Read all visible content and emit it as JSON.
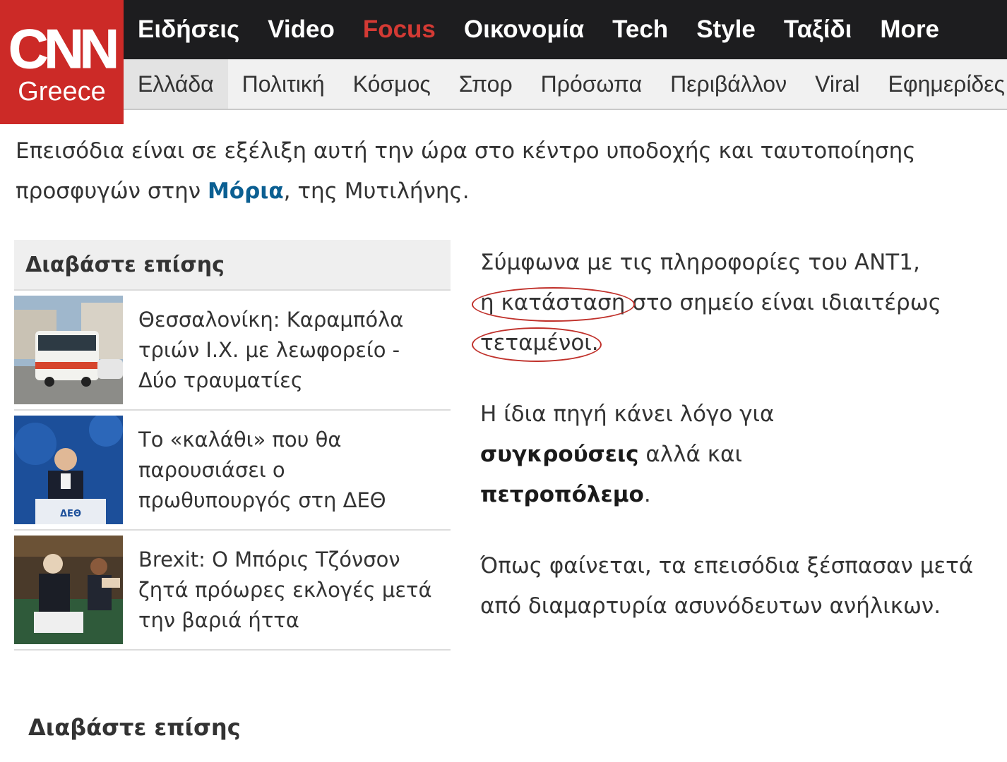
{
  "logo": {
    "mark": "CNN",
    "region": "Greece"
  },
  "topnav": [
    {
      "label": "Ειδήσεις"
    },
    {
      "label": "Video"
    },
    {
      "label": "Focus"
    },
    {
      "label": "Οικονομία"
    },
    {
      "label": "Tech"
    },
    {
      "label": "Style"
    },
    {
      "label": "Ταξίδι"
    },
    {
      "label": "More"
    }
  ],
  "subnav": [
    {
      "label": "Ελλάδα"
    },
    {
      "label": "Πολιτική"
    },
    {
      "label": "Κόσμος"
    },
    {
      "label": "Σπορ"
    },
    {
      "label": "Πρόσωπα"
    },
    {
      "label": "Περιβάλλον"
    },
    {
      "label": "Viral"
    },
    {
      "label": "Εφημερίδες"
    }
  ],
  "intro": {
    "before": "Επεισόδια είναι σε εξέλιξη αυτή την ώρα στο κέντρο υποδοχής και ταυτοποίησης προσφυγών στην ",
    "link": "Μόρια",
    "after": ", της Μυτιλήνης."
  },
  "sidebar": {
    "heading": "Διαβάστε επίσης",
    "items": [
      {
        "title": "Θεσσαλονίκη: Καραμπόλα τριών Ι.Χ. με λεωφορείο - Δύο τραυματίες"
      },
      {
        "title": "Το «καλάθι» που θα παρουσιάσει ο πρωθυπουργός στη ΔΕΘ",
        "thumb_sign": "ΔΕΘ"
      },
      {
        "title": "Brexit: Ο Μπόρις Τζόνσον ζητά πρόωρες εκλογές μετά την βαριά ήττα"
      }
    ]
  },
  "article": {
    "p1": {
      "a": "Σύμφωνα με τις πληροφορίες του ANT1,",
      "ring1": "η κατάσταση",
      "b": " στο σημείο είναι ιδιαιτέρως ",
      "ring2": "τεταμένοι",
      "c": "."
    },
    "p2": {
      "a": "Η ίδια πηγή κάνει λόγο για ",
      "bold1": "συγκρούσεις",
      "b": " αλλά και ",
      "bold2": "πετροπόλεμο",
      "c": "."
    },
    "p3": "Όπως φαίνεται, τα επεισόδια ξέσπασαν μετά από διαμαρτυρία ασυνόδευτων ανήλικων."
  },
  "bottom": {
    "heading": "Διαβάστε επίσης"
  },
  "colors": {
    "brand_red": "#cc2a27",
    "nav_dark": "#1d1d1f",
    "focus": "#d43a34",
    "link": "#0b5f92",
    "annotation": "#c0312b"
  }
}
